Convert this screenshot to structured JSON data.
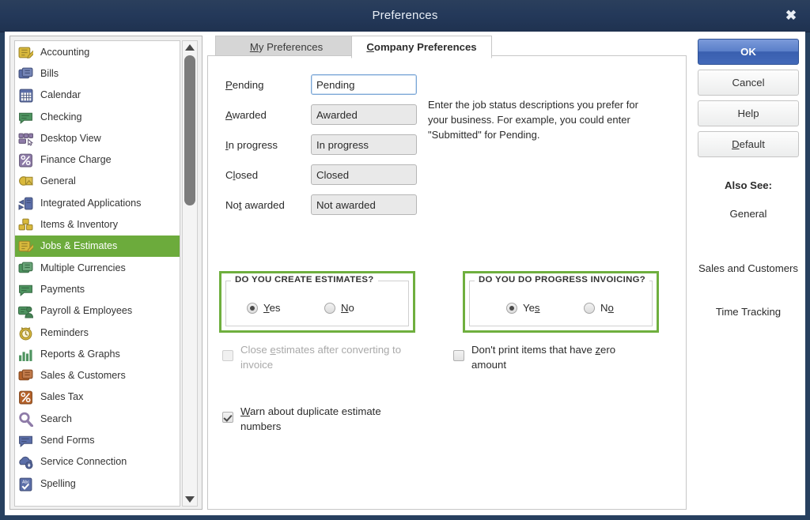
{
  "window": {
    "title": "Preferences",
    "close_icon": "close-icon"
  },
  "sidebar": {
    "items": [
      {
        "label": "Accounting",
        "icon": "accounting-icon",
        "selected": false
      },
      {
        "label": "Bills",
        "icon": "bills-icon",
        "selected": false
      },
      {
        "label": "Calendar",
        "icon": "calendar-icon",
        "selected": false
      },
      {
        "label": "Checking",
        "icon": "checking-icon",
        "selected": false
      },
      {
        "label": "Desktop View",
        "icon": "desktop-view-icon",
        "selected": false
      },
      {
        "label": "Finance Charge",
        "icon": "finance-charge-icon",
        "selected": false
      },
      {
        "label": "General",
        "icon": "general-icon",
        "selected": false
      },
      {
        "label": "Integrated Applications",
        "icon": "integrated-applications-icon",
        "selected": false
      },
      {
        "label": "Items & Inventory",
        "icon": "items-inventory-icon",
        "selected": false
      },
      {
        "label": "Jobs & Estimates",
        "icon": "jobs-estimates-icon",
        "selected": true
      },
      {
        "label": "Multiple Currencies",
        "icon": "multiple-currencies-icon",
        "selected": false
      },
      {
        "label": "Payments",
        "icon": "payments-icon",
        "selected": false
      },
      {
        "label": "Payroll & Employees",
        "icon": "payroll-employees-icon",
        "selected": false
      },
      {
        "label": "Reminders",
        "icon": "reminders-icon",
        "selected": false
      },
      {
        "label": "Reports & Graphs",
        "icon": "reports-graphs-icon",
        "selected": false
      },
      {
        "label": "Sales & Customers",
        "icon": "sales-customers-icon",
        "selected": false
      },
      {
        "label": "Sales Tax",
        "icon": "sales-tax-icon",
        "selected": false
      },
      {
        "label": "Search",
        "icon": "search-icon",
        "selected": false
      },
      {
        "label": "Send Forms",
        "icon": "send-forms-icon",
        "selected": false
      },
      {
        "label": "Service Connection",
        "icon": "service-connection-icon",
        "selected": false
      },
      {
        "label": "Spelling",
        "icon": "spelling-icon",
        "selected": false
      }
    ],
    "selected_label": "Jobs & Estimates",
    "selection_color": "#6cab3c",
    "scroll_up_icon": "scroll-up-arrow-icon",
    "scroll_down_icon": "scroll-down-arrow-icon"
  },
  "tabs": [
    {
      "label": "My Preferences",
      "mnemonic": "M",
      "active": false
    },
    {
      "label": "Company Preferences",
      "mnemonic": "C",
      "active": true
    }
  ],
  "form": {
    "help_text": "Enter the job status descriptions you prefer for your business.  For example, you could enter \"Submitted\" for Pending.",
    "rows": [
      {
        "label": "Pending",
        "mnemonic": "P",
        "value": "Pending",
        "focused": true
      },
      {
        "label": "Awarded",
        "mnemonic": "A",
        "value": "Awarded",
        "focused": false
      },
      {
        "label": "In progress",
        "mnemonic": "I",
        "value": "In progress",
        "focused": false
      },
      {
        "label": "Closed",
        "mnemonic": "l",
        "value": "Closed",
        "focused": false
      },
      {
        "label": "Not awarded",
        "mnemonic": "t",
        "value": "Not awarded",
        "focused": false
      }
    ]
  },
  "groups": {
    "estimates": {
      "legend": "DO YOU CREATE ESTIMATES?",
      "border_color": "#6faf3e",
      "yes_label": "Yes",
      "yes_mnemonic": "Y",
      "no_label": "No",
      "no_mnemonic": "N",
      "selected": "Yes"
    },
    "progress_invoicing": {
      "legend": "DO YOU DO PROGRESS INVOICING?",
      "border_color": "#6faf3e",
      "yes_label": "Yes",
      "yes_mnemonic": "s",
      "no_label": "No",
      "no_mnemonic": "o",
      "selected": "Yes"
    }
  },
  "checkboxes": {
    "close_estimates": {
      "label": "Close estimates after converting to invoice",
      "mnemonic": "e",
      "checked": false,
      "disabled": true
    },
    "dont_print_zero": {
      "label": "Don't print items that have zero amount",
      "mnemonic": "z",
      "checked": false,
      "disabled": false
    },
    "warn_duplicate": {
      "label": "Warn about duplicate estimate numbers",
      "mnemonic": "W",
      "checked": true,
      "disabled": false
    }
  },
  "buttons": {
    "ok": "OK",
    "cancel": "Cancel",
    "help": "Help",
    "default": "Default",
    "default_mnemonic": "D",
    "ok_color": "#4369b9"
  },
  "also_see": {
    "title": "Also See:",
    "links": [
      "General",
      "Sales and Customers",
      "Time Tracking"
    ]
  }
}
